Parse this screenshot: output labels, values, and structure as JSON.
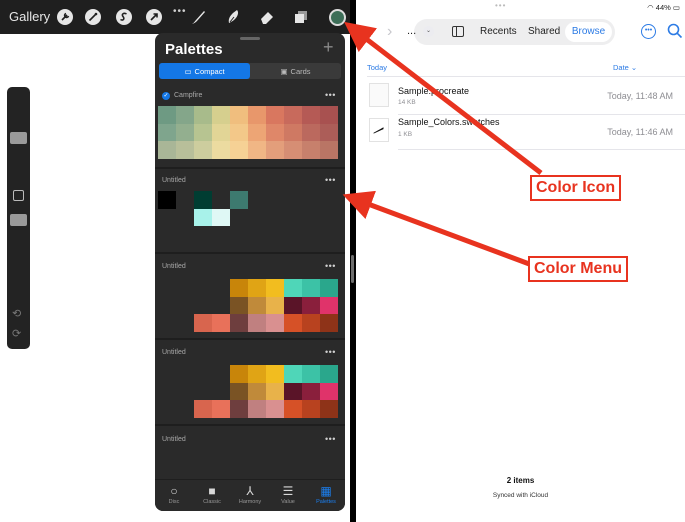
{
  "procreate": {
    "gallery_label": "Gallery",
    "toolbar_dots": "•••",
    "toolbar_icons": [
      "wrench-icon",
      "magic-wand-icon",
      "selection-icon",
      "transform-arrow-icon",
      "brush-icon",
      "smudge-icon",
      "eraser-icon",
      "layers-icon"
    ],
    "current_color": "#3d6e58"
  },
  "palettes": {
    "title": "Palettes",
    "add": "+",
    "tab_compact": "Compact",
    "tab_cards": "Cards",
    "more": "•••",
    "items": [
      {
        "name": "Campfire",
        "default": true,
        "rows": [
          [
            "#6e9a83",
            "#84a68a",
            "#a8bb8b",
            "#d6cf8e",
            "#f0be7e",
            "#e8976b",
            "#d9775f",
            "#c86a5c",
            "#b55a55",
            "#a85150"
          ],
          [
            "#7fa58d",
            "#93af8f",
            "#b7c491",
            "#e2d596",
            "#f3c889",
            "#eda575",
            "#df8769",
            "#cf7963",
            "#bb695e",
            "#ac5d58"
          ],
          [
            "#a9b697",
            "#b8bf9a",
            "#cdcd9e",
            "#ecdba0",
            "#f6d195",
            "#f0b685",
            "#e39e7b",
            "#d68e74",
            "#c7806c",
            "#b97565"
          ]
        ]
      },
      {
        "name": "Untitled",
        "rows": [
          [
            "#000000",
            "",
            "#003d32",
            "",
            "#3d7a6f",
            "",
            "",
            "",
            "",
            ""
          ],
          [
            "",
            "",
            "#a8f2ea",
            "#dff8f5",
            "",
            "",
            "",
            "",
            "",
            ""
          ]
        ]
      },
      {
        "name": "Untitled",
        "rows": [
          [
            "",
            "",
            "",
            "",
            "#c8850a",
            "#e0a415",
            "#f2bd1f",
            "#4fd6b8",
            "#3cc2a6",
            "#2aa78c"
          ],
          [
            "",
            "",
            "",
            "",
            "#7a5324",
            "#c08a3a",
            "#e8b24a",
            "#5a1428",
            "#8a1f3c",
            "#e0336a"
          ],
          [
            "",
            "",
            "#d8654e",
            "#e8715a",
            "#6e3e3e",
            "#c08080",
            "#d99090",
            "#d65127",
            "#b8421f",
            "#8e3318"
          ]
        ]
      },
      {
        "name": "Untitled",
        "rows": [
          [
            "",
            "",
            "",
            "",
            "#c8850a",
            "#e0a415",
            "#f2bd1f",
            "#4fd6b8",
            "#3cc2a6",
            "#2aa78c"
          ],
          [
            "",
            "",
            "",
            "",
            "#7a5324",
            "#c08a3a",
            "#e8b24a",
            "#5a1428",
            "#8a1f3c",
            "#e0336a"
          ],
          [
            "",
            "",
            "#d8654e",
            "#e8715a",
            "#6e3e3e",
            "#c08080",
            "#d99090",
            "#d65127",
            "#b8421f",
            "#8e3318"
          ]
        ]
      },
      {
        "name": "Untitled",
        "rows": []
      }
    ],
    "nav": [
      {
        "label": "Disc",
        "icon": "disc-icon"
      },
      {
        "label": "Classic",
        "icon": "classic-square-icon"
      },
      {
        "label": "Harmony",
        "icon": "harmony-icon"
      },
      {
        "label": "Value",
        "icon": "value-sliders-icon"
      },
      {
        "label": "Palettes",
        "icon": "palettes-grid-icon",
        "active": true
      }
    ]
  },
  "files": {
    "status": "44%",
    "top_dots": "•••",
    "path_ellipsis": "...",
    "tab_recents": "Recents",
    "tab_shared": "Shared",
    "tab_browse": "Browse",
    "sort_group": "Today",
    "sort_by": "Date ⌄",
    "items": [
      {
        "name": "Sample.procreate",
        "size": "14 KB",
        "date": "Today, 11:48 AM"
      },
      {
        "name": "Sample_Colors.swatches",
        "size": "1 KB",
        "date": "Today, 11:46 AM"
      }
    ],
    "footer_count": "2 items",
    "footer_sync": "Synced with iCloud"
  },
  "annotations": {
    "color_icon": "Color Icon",
    "color_menu": "Color Menu",
    "accent": "#e8331f"
  }
}
